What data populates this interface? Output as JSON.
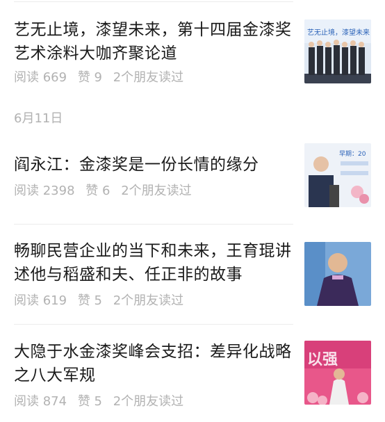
{
  "date_header": "6月11日",
  "articles": [
    {
      "title": "艺无止境，漆望未来，第十四届金漆奖艺术涂料大咖齐聚论道",
      "read": "阅读 669",
      "likes": "赞 9",
      "friends": "2个朋友读过",
      "thumb_text": "艺无止境，漆望未来"
    },
    {
      "title": "阎永江：金漆奖是一份长情的缘分",
      "read": "阅读 2398",
      "likes": "赞 6",
      "friends": "2个朋友读过",
      "thumb_text": "早期：20"
    },
    {
      "title": "畅聊民营企业的当下和未来，王育琨讲述他与稻盛和夫、任正非的故事",
      "read": "阅读 619",
      "likes": "赞 5",
      "friends": "2个朋友读过",
      "thumb_text": ""
    },
    {
      "title": "大隐于水金漆奖峰会支招：差异化战略之八大军规",
      "read": "阅读 874",
      "likes": "赞 5",
      "friends": "2个朋友读过",
      "thumb_text": "以强"
    }
  ]
}
